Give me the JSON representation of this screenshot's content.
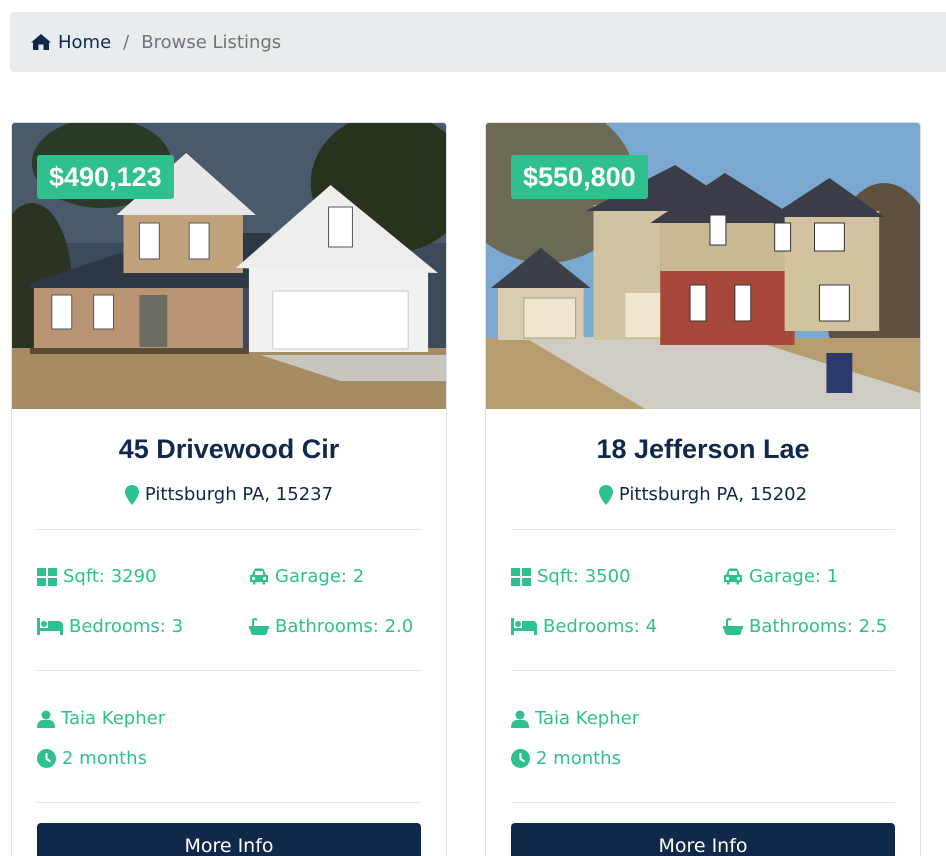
{
  "breadcrumb": {
    "home": "Home",
    "separator": "/",
    "current": "Browse Listings"
  },
  "colors": {
    "accent": "#2fc08f",
    "navy": "#10294a",
    "breadcrumb_bg": "#e9ecef"
  },
  "listings": [
    {
      "price": "$490,123",
      "title": "45 Drivewood Cir",
      "location": "Pittsburgh PA, 15237",
      "sqft": "Sqft: 3290",
      "garage": "Garage: 2",
      "bedrooms": "Bedrooms: 3",
      "bathrooms": "Bathrooms: 2.0",
      "agent": "Taia Kepher",
      "listed": "2 months",
      "button": "More Info"
    },
    {
      "price": "$550,800",
      "title": "18 Jefferson Lae",
      "location": "Pittsburgh PA, 15202",
      "sqft": "Sqft: 3500",
      "garage": "Garage: 1",
      "bedrooms": "Bedrooms: 4",
      "bathrooms": "Bathrooms: 2.5",
      "agent": "Taia Kepher",
      "listed": "2 months",
      "button": "More Info"
    }
  ]
}
